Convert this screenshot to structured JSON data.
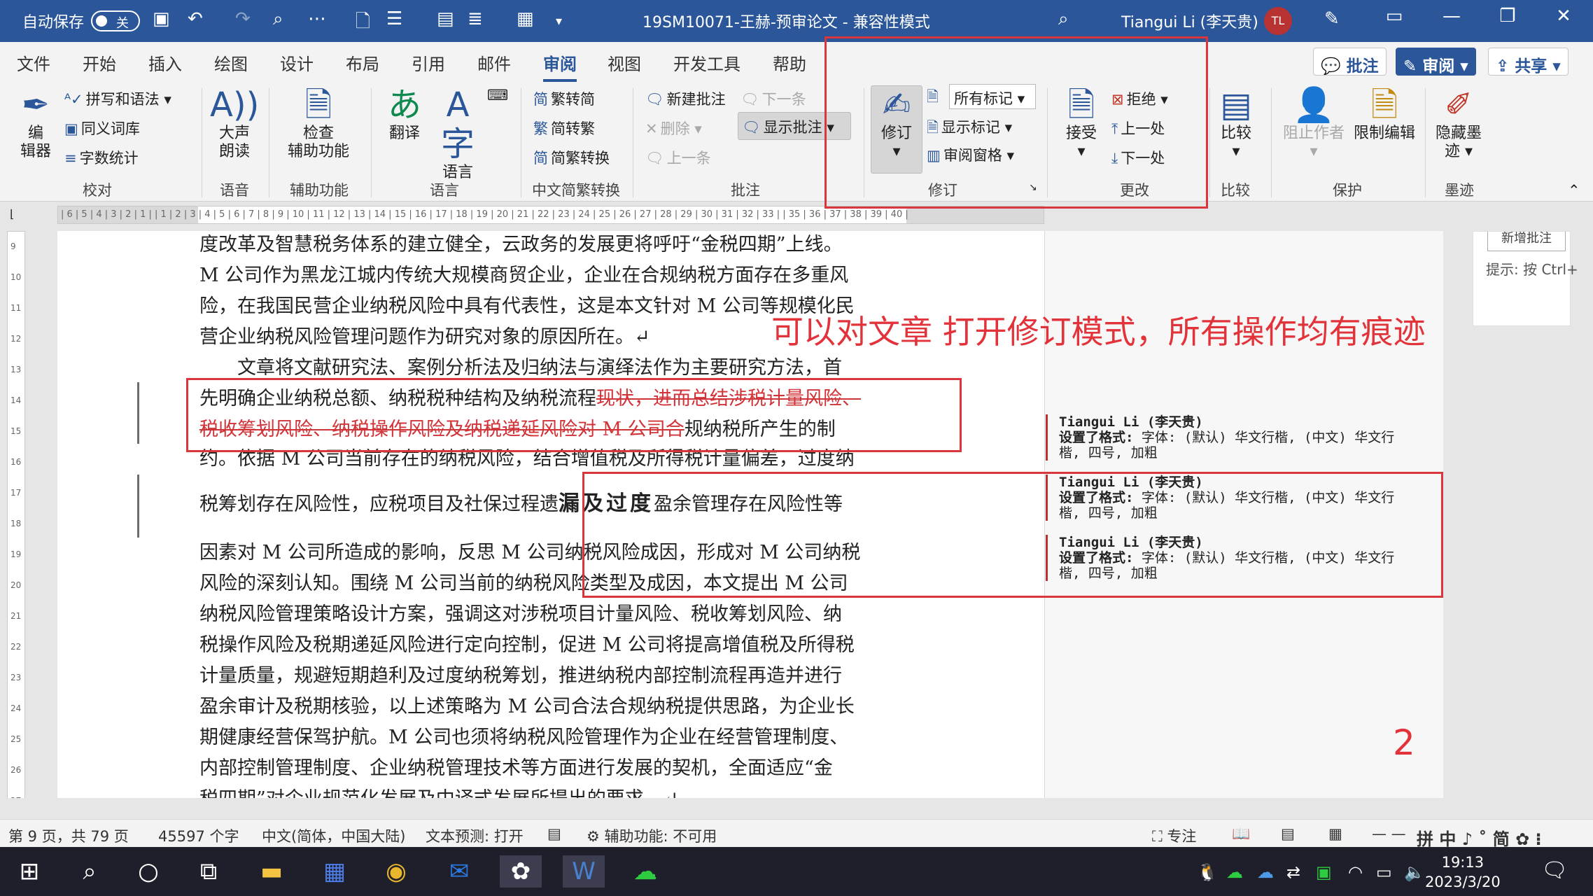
{
  "titlebar": {
    "autosave_label": "自动保存",
    "autosave_state": "关",
    "doc_title": "19SM10071-王赫-预审论文  -  兼容性模式",
    "user_name": "Tiangui Li (李天贵)",
    "user_initials": "TL"
  },
  "tabs": [
    {
      "label": "文件"
    },
    {
      "label": "开始"
    },
    {
      "label": "插入"
    },
    {
      "label": "绘图"
    },
    {
      "label": "设计"
    },
    {
      "label": "布局"
    },
    {
      "label": "引用"
    },
    {
      "label": "邮件"
    },
    {
      "label": "审阅"
    },
    {
      "label": "视图"
    },
    {
      "label": "开发工具"
    },
    {
      "label": "帮助"
    }
  ],
  "ribbon_right": {
    "comments": "批注",
    "review": "审阅",
    "share": "共享"
  },
  "ribbon": {
    "editor": "编\n辑器",
    "spelling": "拼写和语法",
    "thesaurus": "同义词库",
    "wordcount": "字数统计",
    "group_proofing": "校对",
    "read_aloud": "大声\n朗读",
    "group_speech": "语音",
    "check_access": "检查\n辅助功能",
    "group_access": "辅助功能",
    "translate": "翻译",
    "language": "语言",
    "group_language": "语言",
    "trad_to_simp": "繁转简",
    "simp_to_trad": "简转繁",
    "simp_trad_convert": "简繁转换",
    "group_chinese": "中文简繁转换",
    "new_comment": "新建批注",
    "delete": "删除",
    "prev_comment": "上一条",
    "next_comment": "下一条",
    "show_comments": "显示批注",
    "group_comments": "批注",
    "track_changes": "修订",
    "all_markup": "所有标记",
    "show_markup": "显示标记",
    "review_pane": "审阅窗格",
    "group_tracking": "修订",
    "accept": "接受",
    "reject": "拒绝",
    "previous": "上一处",
    "next": "下一处",
    "group_changes": "更改",
    "compare": "比较",
    "group_compare": "比较",
    "block_authors": "阻止作者",
    "restrict_editing": "限制编辑",
    "group_protect": "保护",
    "hide_ink": "隐藏墨\n迹",
    "group_ink": "墨迹"
  },
  "ruler_text": "| 6 | 5 | 4 | 3 | 2 | 1 |   | 1 | 2 | 3 | 4 | 5 | 6 | 7 | 8 | 9 | 10 | 11 | 12 | 13 | 14 | 15 | 16 | 17 | 18 | 19 | 20 | 21 | 22 | 23 | 24 | 25 | 26 | 27 | 28 | 29 | 30 | 31 | 32 | 33 |   | 35 | 36 | 37 | 38 | 39 | 40 |",
  "document": {
    "lines": [
      "度改革及智慧税务体系的建立健全，云政务的发展更将呼吁“金税四期”上线。",
      "M 公司作为黑龙江城内传统大规模商贸企业，企业在合规纳税方面存在多重风",
      "险，在我国民营企业纳税风险中具有代表性，这是本文针对 M 公司等规模化民",
      "营企业纳税风险管理问题作为研究对象的原因所在。↵",
      "　　文章将文献研究法、案例分析法及归纳法与演绎法作为主要研究方法，首"
    ],
    "line6_normal": "先明确企业纳税总额、纳税税种结构及纳税流程",
    "line6_deleted": "现状，进而总结涉税计量风险、",
    "line7_deleted": "税收筹划风险、纳税操作风险及纳税递延风险对  M  公司合",
    "line7_normal": "规纳税所产生的制",
    "line8": "约。依据 M 公司当前存在的纳税风险，结合增值税及所得税计量偏差，过度纳",
    "line9_a": "税筹划存在风险性，应税项目及社保过程遗",
    "line9_b": "漏及过度",
    "line9_c": "盈余管理存在风险性等",
    "lines_after": [
      "因素对 M 公司所造成的影响，反思 M 公司纳税风险成因，形成对 M 公司纳税",
      "风险的深刻认知。围绕 M 公司当前的纳税风险类型及成因，本文提出 M 公司",
      "纳税风险管理策略设计方案，强调这对涉税项目计量风险、税收筹划风险、纳",
      "税操作风险及税期递延风险进行定向控制，促进 M 公司将提高增值税及所得税",
      "计量质量，规避短期趋利及过度纳税筹划，推进纳税内部控制流程再造并进行",
      "盈余审计及税期核验，以上述策略为 M 公司合法合规纳税提供思路，为企业长",
      "期健康经营保驾护航。M 公司也须将纳税风险管理作为企业在经营管理制度、",
      "内部控制管理制度、企业纳税管理技术等方面进行发展的契机，全面适应“金",
      "税四期”对企业规范化发展及中译式发展所提出的要求。↵"
    ]
  },
  "comments": [
    {
      "author": "Tiangui Li (李天贵)",
      "key": "设置了格式:",
      "l1": " 字体: (默认) 华文行楷, (中文) 华文行",
      "l2": "楷, 四号, 加粗"
    },
    {
      "author": "Tiangui Li (李天贵)",
      "key": "设置了格式:",
      "l1": " 字体: (默认) 华文行楷, (中文) 华文行",
      "l2": "楷, 四号, 加粗"
    },
    {
      "author": "Tiangui Li (李天贵)",
      "key": "设置了格式:",
      "l1": " 字体: (默认) 华文行楷, (中文) 华文行",
      "l2": "楷, 四号, 加粗"
    }
  ],
  "right_comment": {
    "button": "新增批注",
    "hint": "提示: 按 Ctrl+"
  },
  "annotation": {
    "main": "可以对文章 打开修订模式，所有操作均有痕迹",
    "number": "2"
  },
  "status": {
    "page": "第 9 页，共 79 页",
    "words": "45597 个字",
    "lang": "中文(简体，中国大陆)",
    "predict": "文本预测: 打开",
    "access": "辅助功能: 不可用",
    "focus": "专注",
    "ime": "拼 中 ♪ ˚ 简 ✿ ⁝"
  },
  "clock": {
    "time": "19:13",
    "date": "2023/3/20"
  }
}
